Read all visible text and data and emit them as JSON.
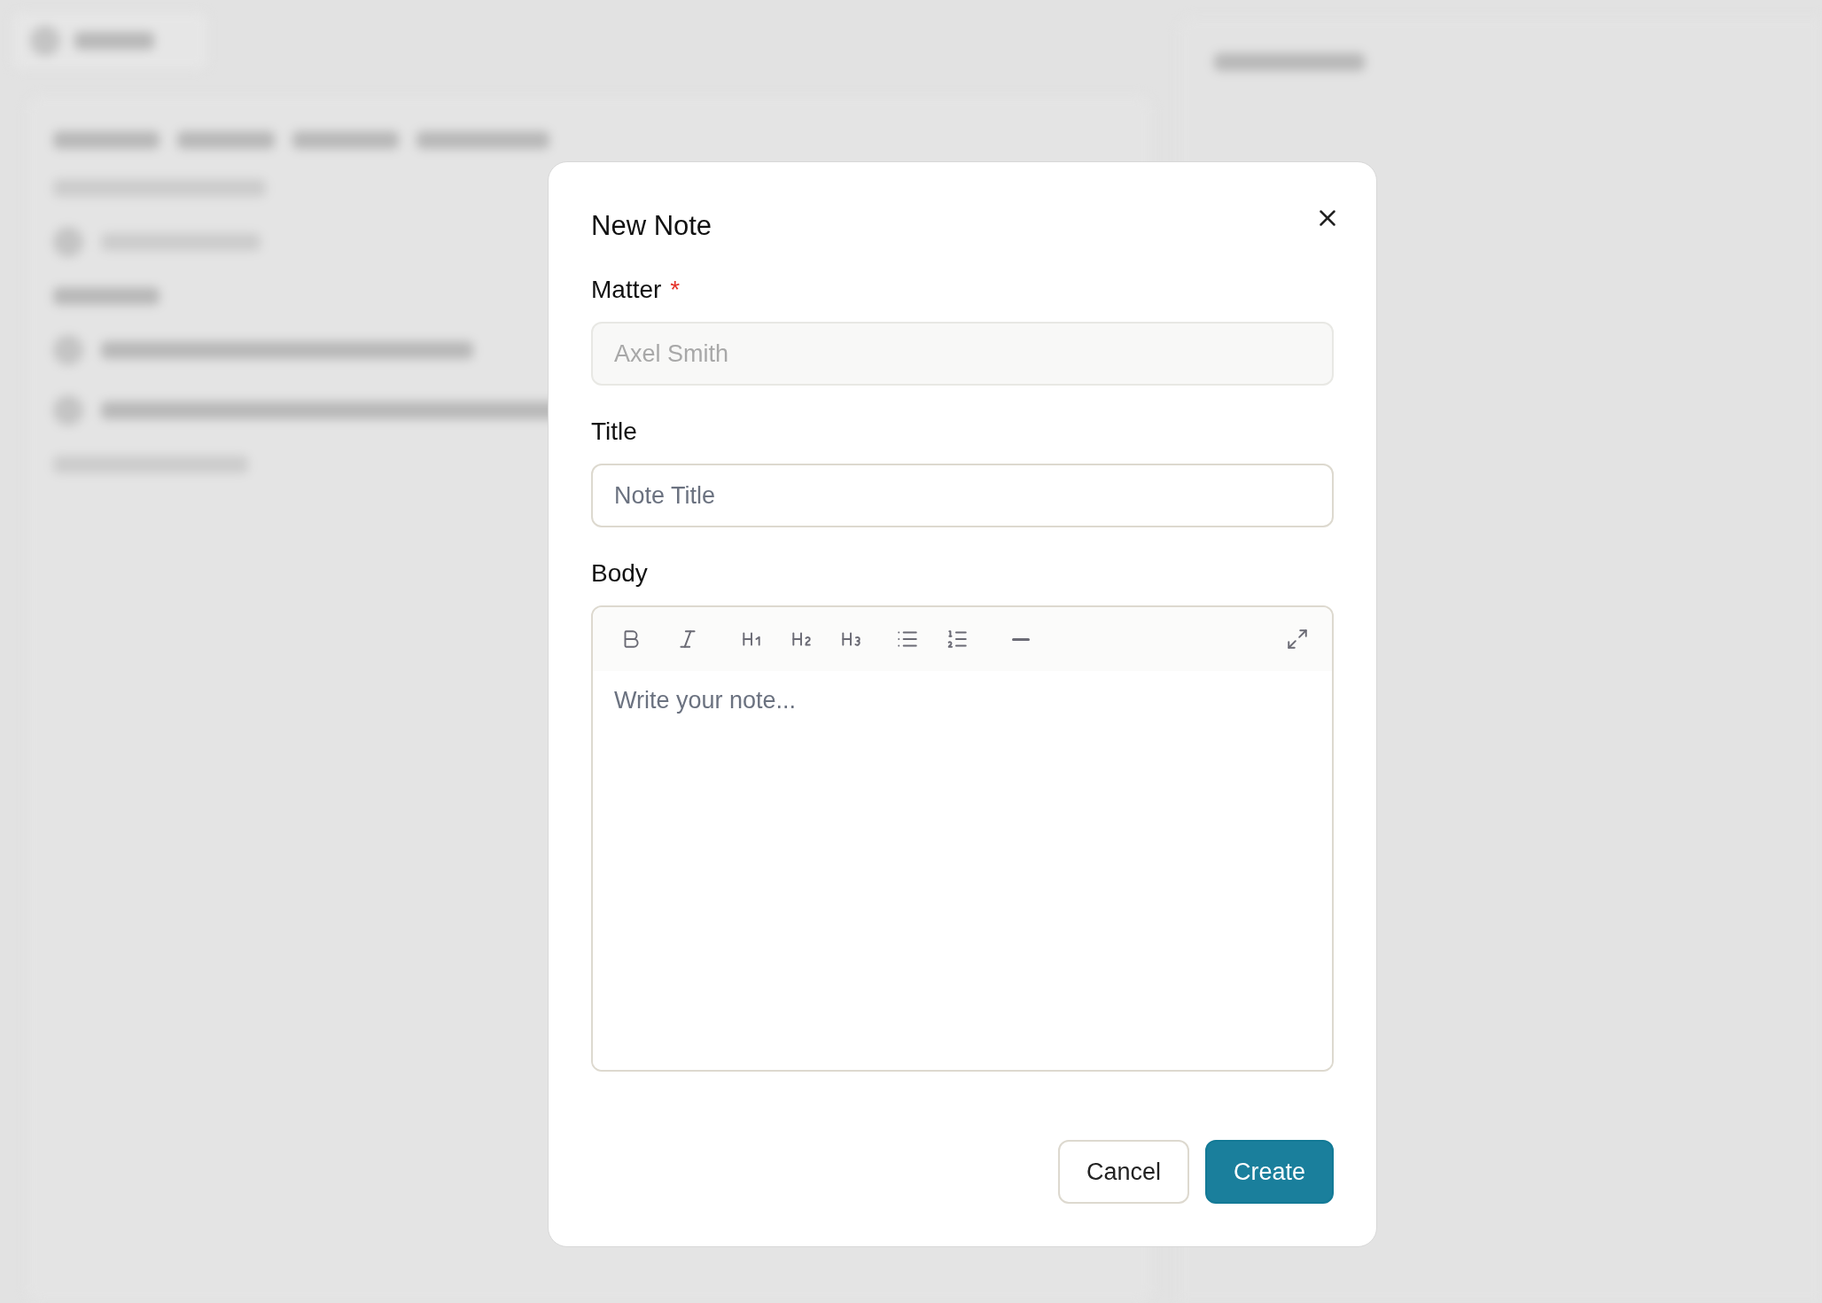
{
  "dialog": {
    "title": "New Note",
    "fields": [
      {
        "kind": "input",
        "label": "Matter",
        "required_mark": "*",
        "placeholder": "Axel Smith",
        "disabled": true
      },
      {
        "kind": "input",
        "label": "Title",
        "placeholder": "Note Title",
        "disabled": false
      },
      {
        "kind": "editor",
        "label": "Body",
        "placeholder": "Write your note..."
      }
    ],
    "buttons": [
      {
        "label": "Cancel",
        "kind": "secondary"
      },
      {
        "label": "Create",
        "kind": "primary"
      }
    ]
  }
}
